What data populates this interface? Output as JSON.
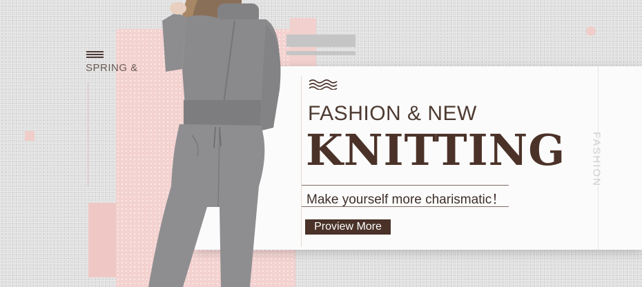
{
  "banner": {
    "season_label": "SPRING &",
    "headline": "FASHION & NEW",
    "title": "KNITTING",
    "tagline": "Make yourself more charismatic！",
    "cta_label": "Proview  More",
    "side_label": "FASHION"
  },
  "colors": {
    "background": "#dcdcdc",
    "pink": "#f3d2d0",
    "brown": "#4b3228",
    "sweater_gray": "#8a8a8c",
    "card": "#fbfbfb"
  },
  "icons": {
    "stripes": "stripes-icon",
    "wave": "wave-icon"
  }
}
